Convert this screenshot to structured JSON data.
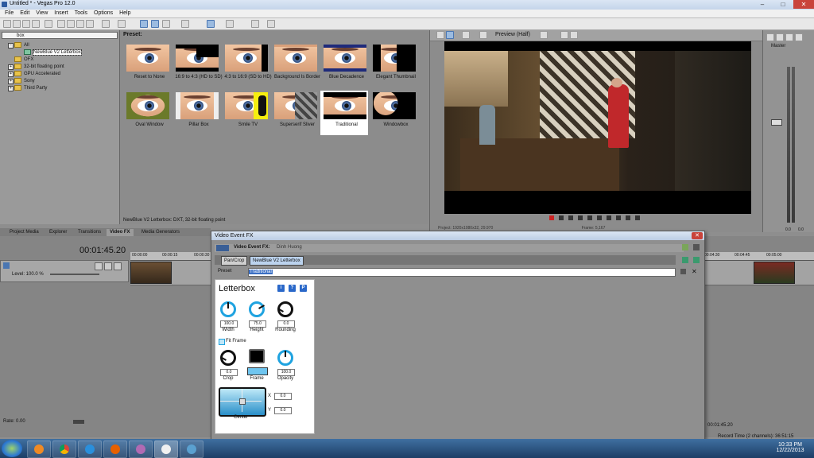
{
  "window": {
    "title": "Untitled * - Vegas Pro 12.0",
    "min": "–",
    "max": "□",
    "close": "✕"
  },
  "menu": [
    "File",
    "Edit",
    "View",
    "Insert",
    "Tools",
    "Options",
    "Help"
  ],
  "explorer": {
    "search": "box",
    "items": [
      "All",
      "NewBlue V2 Letterbox",
      "OFX",
      "32-bit floating point",
      "GPU Accelerated",
      "Sony",
      "Third Party"
    ],
    "selected": "NewBlue V2 Letterbox"
  },
  "presets": {
    "title": "Preset:",
    "items": [
      "Reset to None",
      "16:9 to 4:3 (HD to SD)",
      "4:3 to 16:9 (SD to HD)",
      "Background Is Border",
      "Blue Decadence",
      "Elegant Thumbnail",
      "Oval Window",
      "Pillar Box",
      "Smile TV",
      "Superserif Sliver",
      "Traditional",
      "Windowbox"
    ],
    "selected": "Traditional",
    "status": "NewBlue V2 Letterbox: DXT, 32-bit floating point"
  },
  "preview": {
    "label": "Preview (Half)",
    "status_left": "Project: 1920x1080x32, 29.970",
    "status_right": "Frame: 5,167"
  },
  "master": {
    "label": "Master",
    "db_left": "0.0",
    "db_right": "0.0"
  },
  "tabs": [
    "Project Media",
    "Explorer",
    "Transitions",
    "Video FX",
    "Media Generators"
  ],
  "active_tab": "Video FX",
  "timeline": {
    "timecode": "00:01:45.20",
    "level": "Level: 100.0 %",
    "ruler": [
      "00:00:00",
      "00:00:15",
      "00:00:30",
      "00:04:30",
      "00:04:45",
      "00:05:00"
    ],
    "rate": "Rate: 0.00",
    "bottom_timecode": "00:01:45.20",
    "record_time": "Record Time (2 channels): 36:51:15"
  },
  "dialog": {
    "title": "Video Event FX",
    "header_label": "Video Event FX:",
    "header_value": "Dinh Huong",
    "chain": [
      "Pan/Crop",
      "NewBlue V2 Letterbox"
    ],
    "preset_label": "Preset",
    "preset_value": "Traditional",
    "close": "✕"
  },
  "plugin": {
    "title": "Letterbox",
    "buttons": [
      "i",
      "?",
      "P"
    ],
    "width": {
      "label": "Width",
      "value": "100.0"
    },
    "height": {
      "label": "Height",
      "value": "75.0"
    },
    "rounding": {
      "label": "Rounding",
      "value": "0.0"
    },
    "fit_frame": "Fit Frame",
    "crop": {
      "label": "Crop",
      "value": "0.0"
    },
    "frame": {
      "label": "Frame"
    },
    "opacity": {
      "label": "Opacity",
      "value": "100.0"
    },
    "center": {
      "label": "Center",
      "x_label": "X",
      "x": "0.0",
      "y_label": "Y",
      "y": "0.0"
    }
  },
  "taskbar": {
    "time": "10:33 PM",
    "date": "12/22/2013"
  },
  "colors": {
    "accent": "#3a6fc4",
    "knob_blue": "#1fa3e0",
    "taskbar": "#1d3e66"
  }
}
